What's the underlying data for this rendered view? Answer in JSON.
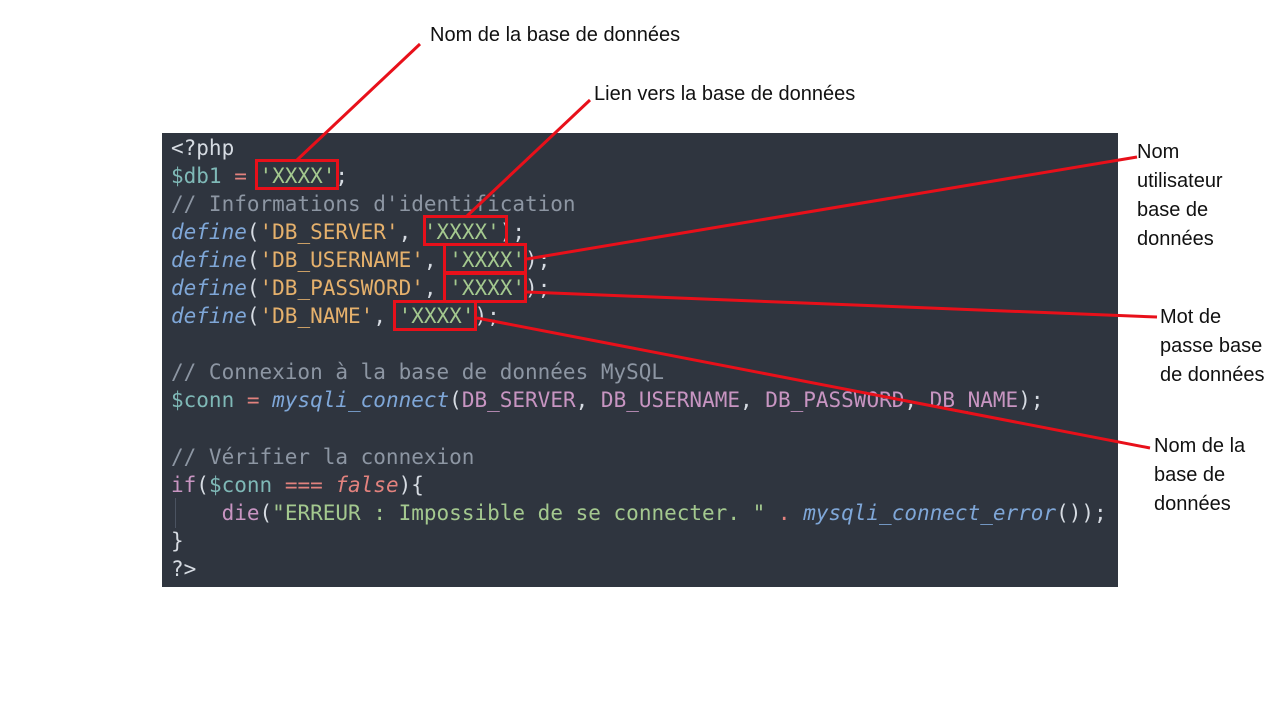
{
  "code": {
    "lines": [
      [
        {
          "t": "<?php",
          "c": "plain"
        }
      ],
      [
        {
          "t": "$db1",
          "c": "var"
        },
        {
          "t": " = ",
          "c": "op"
        },
        {
          "t": "'XXXX'",
          "c": "str"
        },
        {
          "t": ";",
          "c": "plain"
        }
      ],
      [
        {
          "t": "// Informations d'identification",
          "c": "cmt"
        }
      ],
      [
        {
          "t": "define",
          "c": "func"
        },
        {
          "t": "(",
          "c": "plain"
        },
        {
          "t": "'DB_SERVER'",
          "c": "key"
        },
        {
          "t": ", ",
          "c": "plain"
        },
        {
          "t": "'XXXX'",
          "c": "str"
        },
        {
          "t": ");",
          "c": "plain"
        }
      ],
      [
        {
          "t": "define",
          "c": "func"
        },
        {
          "t": "(",
          "c": "plain"
        },
        {
          "t": "'DB_USERNAME'",
          "c": "key"
        },
        {
          "t": ", ",
          "c": "plain"
        },
        {
          "t": "'XXXX'",
          "c": "str"
        },
        {
          "t": ");",
          "c": "plain"
        }
      ],
      [
        {
          "t": "define",
          "c": "func"
        },
        {
          "t": "(",
          "c": "plain"
        },
        {
          "t": "'DB_PASSWORD'",
          "c": "key"
        },
        {
          "t": ", ",
          "c": "plain"
        },
        {
          "t": "'XXXX'",
          "c": "str"
        },
        {
          "t": ");",
          "c": "plain"
        }
      ],
      [
        {
          "t": "define",
          "c": "func"
        },
        {
          "t": "(",
          "c": "plain"
        },
        {
          "t": "'DB_NAME'",
          "c": "key"
        },
        {
          "t": ", ",
          "c": "plain"
        },
        {
          "t": "'XXXX'",
          "c": "str"
        },
        {
          "t": ");",
          "c": "plain"
        }
      ],
      [],
      [
        {
          "t": "// Connexion à la base de données MySQL",
          "c": "cmt"
        }
      ],
      [
        {
          "t": "$conn",
          "c": "var"
        },
        {
          "t": " = ",
          "c": "op"
        },
        {
          "t": "mysqli_connect",
          "c": "func"
        },
        {
          "t": "(",
          "c": "plain"
        },
        {
          "t": "DB_SERVER",
          "c": "const"
        },
        {
          "t": ", ",
          "c": "plain"
        },
        {
          "t": "DB_USERNAME",
          "c": "const"
        },
        {
          "t": ", ",
          "c": "plain"
        },
        {
          "t": "DB_PASSWORD",
          "c": "const"
        },
        {
          "t": ", ",
          "c": "plain"
        },
        {
          "t": "DB_NAME",
          "c": "const"
        },
        {
          "t": ");",
          "c": "plain"
        }
      ],
      [],
      [
        {
          "t": "// Vérifier la connexion",
          "c": "cmt"
        }
      ],
      [
        {
          "t": "if",
          "c": "kw"
        },
        {
          "t": "(",
          "c": "plain"
        },
        {
          "t": "$conn",
          "c": "var"
        },
        {
          "t": " === ",
          "c": "op"
        },
        {
          "t": "false",
          "c": "false"
        },
        {
          "t": "){",
          "c": "plain"
        }
      ],
      [
        {
          "t": "    ",
          "c": "plain"
        },
        {
          "t": "die",
          "c": "die"
        },
        {
          "t": "(",
          "c": "plain"
        },
        {
          "t": "\"ERREUR : Impossible de se connecter. \"",
          "c": "str"
        },
        {
          "t": " . ",
          "c": "op"
        },
        {
          "t": "mysqli_connect_error",
          "c": "func"
        },
        {
          "t": "());",
          "c": "plain"
        }
      ],
      [
        {
          "t": "}",
          "c": "plain"
        }
      ],
      [
        {
          "t": "?>",
          "c": "plain"
        }
      ]
    ]
  },
  "callouts": {
    "db1_name": "Nom de la base de données",
    "server_link": "Lien vers la base de données",
    "username": "Nom\nutilisateur\nbase de\ndonnées",
    "password": "Mot de\npasse base\nde données",
    "db_name": "Nom de la\nbase de\ndonnées"
  },
  "colors": {
    "background": "#2f353f",
    "highlight": "#e8101a"
  }
}
